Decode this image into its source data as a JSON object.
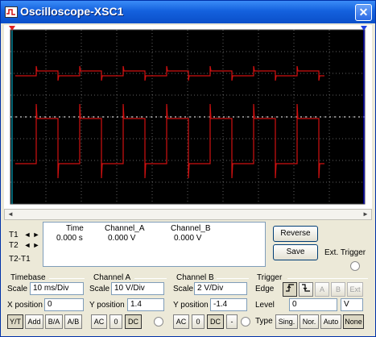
{
  "window": {
    "title": "Oscilloscope-XSC1",
    "close_symbol": "✕"
  },
  "colors": {
    "background": "#000000",
    "grid": "#c0c0c0",
    "trace": "#d01010",
    "cursor_t1": "#00c0e0",
    "cursor_t2": "#0000ff",
    "title_bar": "#1461de"
  },
  "cursors": {
    "t1": "T1",
    "t2": "T2",
    "t2_t1": "T2-T1",
    "left_arrow": "◄",
    "right_arrow": "►"
  },
  "readout": {
    "headers": [
      "Time",
      "Channel_A",
      "Channel_B"
    ],
    "values": [
      "0.000 s",
      "0.000 V",
      "0.000 V"
    ]
  },
  "buttons": {
    "reverse": "Reverse",
    "save": "Save",
    "ext_trigger": "Ext. Trigger"
  },
  "timebase": {
    "title": "Timebase",
    "scale_label": "Scale",
    "scale": "10 ms/Div",
    "xpos_label": "X position",
    "xpos": "0",
    "modes": [
      "Y/T",
      "Add",
      "B/A",
      "A/B"
    ]
  },
  "channel_a": {
    "title": "Channel A",
    "scale_label": "Scale",
    "scale": "10  V/Div",
    "ypos_label": "Y position",
    "ypos": "1.4",
    "couplings": [
      "AC",
      "0",
      "DC"
    ]
  },
  "channel_b": {
    "title": "Channel B",
    "scale_label": "Scale",
    "scale": "2  V/Div",
    "ypos_label": "Y position",
    "ypos": "-1.4",
    "couplings": [
      "AC",
      "0",
      "DC",
      "-"
    ]
  },
  "trigger": {
    "title": "Trigger",
    "edge_label": "Edge",
    "edges": [
      "rising",
      "falling"
    ],
    "sources": [
      "A",
      "B",
      "Ext"
    ],
    "level_label": "Level",
    "level": "0",
    "level_unit": "V",
    "type_label": "Type",
    "types": [
      "Sing.",
      "Nor.",
      "Auto",
      "None"
    ]
  }
}
